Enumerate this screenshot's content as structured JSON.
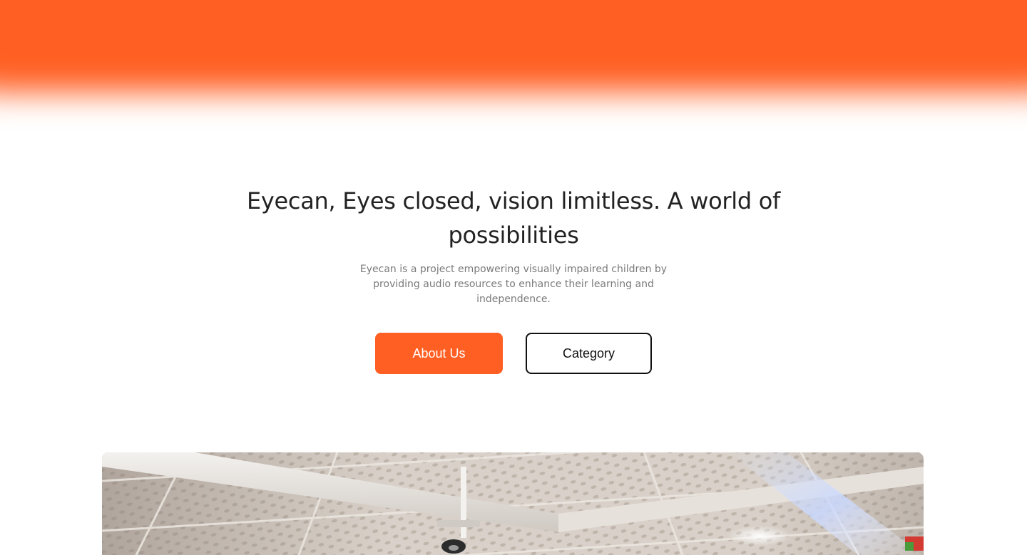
{
  "brand": {
    "accent_color": "#ff5f22",
    "text_color": "#222222",
    "muted_text_color": "#7a7a7a"
  },
  "hero": {
    "headline": "Eyecan, Eyes closed, vision limitless. A world of possibilities",
    "subtext": "Eyecan is a project empowering visually impaired children by providing audio resources to enhance their learning and independence.",
    "primary_button": "About Us",
    "secondary_button": "Category"
  },
  "media": {
    "photo_subject": "classroom ceiling with tiles and a projector"
  }
}
